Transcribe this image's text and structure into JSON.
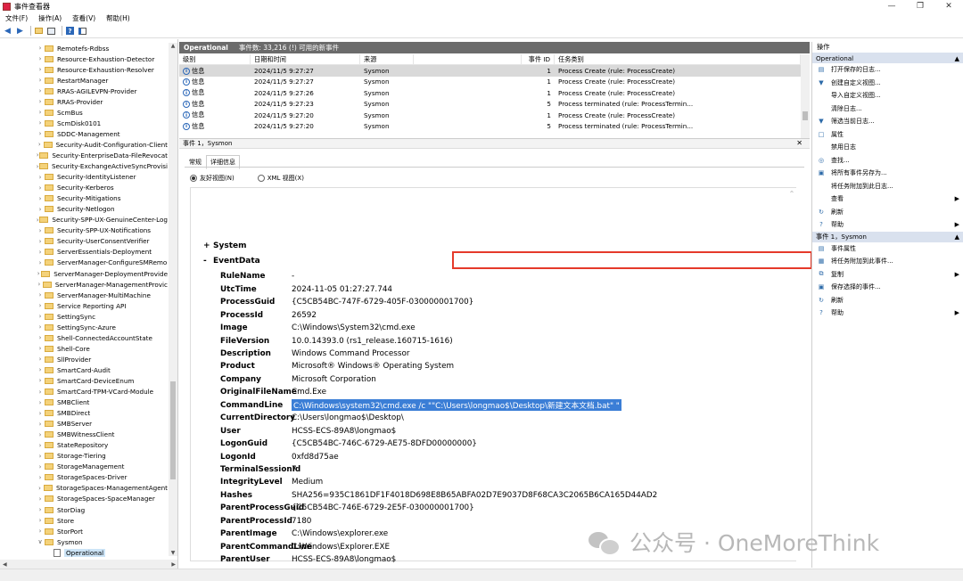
{
  "window": {
    "title": "事件查看器",
    "controls": [
      "—",
      "❐",
      "✕"
    ]
  },
  "menu": [
    "文件(F)",
    "操作(A)",
    "查看(V)",
    "帮助(H)"
  ],
  "tree": {
    "items": [
      "Remotefs-Rdbss",
      "Resource-Exhaustion-Detector",
      "Resource-Exhaustion-Resolver",
      "RestartManager",
      "RRAS-AGILEVPN-Provider",
      "RRAS-Provider",
      "ScmBus",
      "ScmDisk0101",
      "SDDC-Management",
      "Security-Audit-Configuration-Client",
      "Security-EnterpriseData-FileRevocat",
      "Security-ExchangeActiveSyncProvisi",
      "Security-IdentityListener",
      "Security-Kerberos",
      "Security-Mitigations",
      "Security-Netlogon",
      "Security-SPP-UX-GenuineCenter-Log",
      "Security-SPP-UX-Notifications",
      "Security-UserConsentVerifier",
      "ServerEssentials-Deployment",
      "ServerManager-ConfigureSMRemo",
      "ServerManager-DeploymentProvide",
      "ServerManager-ManagementProvic",
      "ServerManager-MultiMachine",
      "Service Reporting API",
      "SettingSync",
      "SettingSync-Azure",
      "Shell-ConnectedAccountState",
      "Shell-Core",
      "SllProvider",
      "SmartCard-Audit",
      "SmartCard-DeviceEnum",
      "SmartCard-TPM-VCard-Module",
      "SMBClient",
      "SMBDirect",
      "SMBServer",
      "SMBWitnessClient",
      "StateRepository",
      "Storage-Tiering",
      "StorageManagement",
      "StorageSpaces-Driver",
      "StorageSpaces-ManagementAgent",
      "StorageSpaces-SpaceManager",
      "StorDiag",
      "Store",
      "StorPort",
      "Sysmon"
    ],
    "selected": "Operational"
  },
  "log": {
    "name": "Operational",
    "summary": "事件数: 33,216 (!) 可用的新事件"
  },
  "columns": {
    "level": "级别",
    "time": "日期和时间",
    "source": "来源",
    "id": "事件 ID",
    "task": "任务类别"
  },
  "events": [
    {
      "level": "信息",
      "time": "2024/11/5 9:27:27",
      "source": "Sysmon",
      "id": "1",
      "task": "Process Create (rule: ProcessCreate)"
    },
    {
      "level": "信息",
      "time": "2024/11/5 9:27:27",
      "source": "Sysmon",
      "id": "1",
      "task": "Process Create (rule: ProcessCreate)"
    },
    {
      "level": "信息",
      "time": "2024/11/5 9:27:26",
      "source": "Sysmon",
      "id": "1",
      "task": "Process Create (rule: ProcessCreate)"
    },
    {
      "level": "信息",
      "time": "2024/11/5 9:27:23",
      "source": "Sysmon",
      "id": "5",
      "task": "Process terminated (rule: ProcessTermin..."
    },
    {
      "level": "信息",
      "time": "2024/11/5 9:27:20",
      "source": "Sysmon",
      "id": "1",
      "task": "Process Create (rule: ProcessCreate)"
    },
    {
      "level": "信息",
      "time": "2024/11/5 9:27:20",
      "source": "Sysmon",
      "id": "5",
      "task": "Process terminated (rule: ProcessTermin..."
    }
  ],
  "detail": {
    "header": "事件 1，Sysmon",
    "tabs": [
      "常规",
      "详细信息"
    ],
    "view_friendly": "友好视图(N)",
    "view_xml": "XML 视图(X)",
    "sections": {
      "system": "System",
      "eventdata": "EventData"
    },
    "fields": [
      {
        "k": "RuleName",
        "v": "-"
      },
      {
        "k": "UtcTime",
        "v": "2024-11-05 01:27:27.744"
      },
      {
        "k": "ProcessGuid",
        "v": "{C5CB54BC-747F-6729-405F-030000001700}"
      },
      {
        "k": "ProcessId",
        "v": "26592"
      },
      {
        "k": "Image",
        "v": "C:\\Windows\\System32\\cmd.exe"
      },
      {
        "k": "FileVersion",
        "v": "10.0.14393.0 (rs1_release.160715-1616)"
      },
      {
        "k": "Description",
        "v": "Windows Command Processor"
      },
      {
        "k": "Product",
        "v": "Microsoft® Windows® Operating System"
      },
      {
        "k": "Company",
        "v": "Microsoft Corporation"
      },
      {
        "k": "OriginalFileName",
        "v": "Cmd.Exe"
      },
      {
        "k": "CommandLine",
        "v": "C:\\Windows\\system32\\cmd.exe /c \"\"C:\\Users\\longmao$\\Desktop\\新建文本文档.bat\" \""
      },
      {
        "k": "CurrentDirectory",
        "v": "C:\\Users\\longmao$\\Desktop\\"
      },
      {
        "k": "User",
        "v": "HCSS-ECS-89A8\\longmao$"
      },
      {
        "k": "LogonGuid",
        "v": "{C5CB54BC-746C-6729-AE75-8DFD00000000}"
      },
      {
        "k": "LogonId",
        "v": "0xfd8d75ae"
      },
      {
        "k": "TerminalSessionId",
        "v": "7"
      },
      {
        "k": "IntegrityLevel",
        "v": "Medium"
      },
      {
        "k": "Hashes",
        "v": "SHA256=935C1861DF1F4018D698E8B65ABFA02D7E9037D8F68CA3C2065B6CA165D44AD2"
      },
      {
        "k": "ParentProcessGuid",
        "v": "{C5CB54BC-746E-6729-2E5F-030000001700}"
      },
      {
        "k": "ParentProcessId",
        "v": "7180"
      },
      {
        "k": "ParentImage",
        "v": "C:\\Windows\\explorer.exe"
      },
      {
        "k": "ParentCommandLine",
        "v": "C:\\Windows\\Explorer.EXE"
      },
      {
        "k": "ParentUser",
        "v": "HCSS-ECS-89A8\\longmao$"
      }
    ]
  },
  "actions": {
    "title": "操作",
    "group1": "Operational",
    "group1_items": [
      {
        "icon": "open-icon",
        "label": "打开保存的日志...",
        "arrow": false
      },
      {
        "icon": "filter-icon",
        "label": "创建自定义视图...",
        "arrow": false
      },
      {
        "icon": "",
        "label": "导入自定义视图...",
        "arrow": false
      },
      {
        "icon": "",
        "label": "清除日志...",
        "arrow": false
      },
      {
        "icon": "filter-icon",
        "label": "筛选当前日志...",
        "arrow": false
      },
      {
        "icon": "properties-icon",
        "label": "属性",
        "arrow": false
      },
      {
        "icon": "",
        "label": "禁用日志",
        "arrow": false
      },
      {
        "icon": "find-icon",
        "label": "查找...",
        "arrow": false
      },
      {
        "icon": "save-icon",
        "label": "将所有事件另存为...",
        "arrow": false
      },
      {
        "icon": "",
        "label": "将任务附加到此日志...",
        "arrow": false
      },
      {
        "icon": "",
        "label": "查看",
        "arrow": true
      },
      {
        "icon": "refresh-icon",
        "label": "刷新",
        "arrow": false
      },
      {
        "icon": "help-icon",
        "label": "帮助",
        "arrow": true
      }
    ],
    "group2": "事件 1，Sysmon",
    "group2_items": [
      {
        "icon": "event-properties-icon",
        "label": "事件属性",
        "arrow": false
      },
      {
        "icon": "task-icon",
        "label": "将任务附加到此事件...",
        "arrow": false
      },
      {
        "icon": "copy-icon",
        "label": "复制",
        "arrow": true
      },
      {
        "icon": "save-icon",
        "label": "保存选择的事件...",
        "arrow": false
      },
      {
        "icon": "refresh-icon",
        "label": "刷新",
        "arrow": false
      },
      {
        "icon": "help-icon",
        "label": "帮助",
        "arrow": true
      }
    ]
  },
  "watermark": "公众号 · OneMoreThink"
}
